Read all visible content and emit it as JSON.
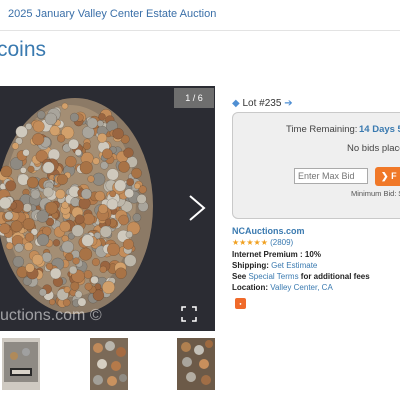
{
  "breadcrumb": "2025 January Valley Center Estate Auction",
  "title": "coins",
  "gallery": {
    "counter": "1 / 6",
    "watermark": "uctions.com ©"
  },
  "lot": {
    "number": "Lot #235",
    "time_remaining_label": "Time Remaining:",
    "time_remaining_value": "14 Days 5",
    "no_bids": "No bids place",
    "max_bid_placeholder": "Enter Max Bid",
    "bid_button": "F",
    "min_bid": "Minimum Bid: $"
  },
  "seller": {
    "name": "NCAuctions.com",
    "stars": "★★★★★",
    "rating_count": "(2809)",
    "internet_premium_label": "Internet Premium :",
    "internet_premium_value": "10%",
    "shipping_label": "Shipping:",
    "shipping_value": "Get Estimate",
    "terms_prefix": "See",
    "terms_link": "Special Terms",
    "terms_suffix": "for additional fees",
    "location_label": "Location:",
    "location_value": "Valley Center, CA"
  },
  "colors": {
    "accent": "#3a7ab0",
    "bid_button": "#f07828",
    "stars": "#f0a020"
  }
}
